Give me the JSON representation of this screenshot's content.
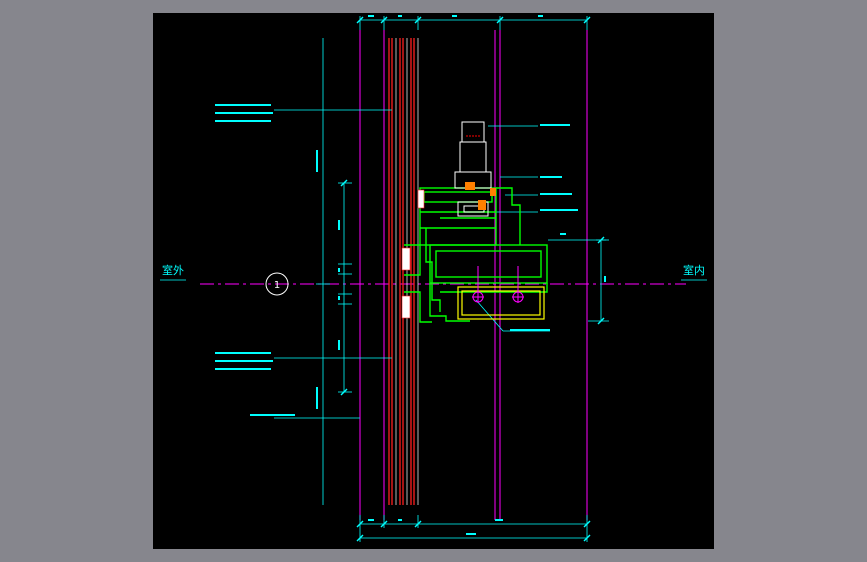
{
  "drawing": {
    "labels": {
      "exterior": "室外",
      "interior": "室内",
      "section_marker": "1"
    },
    "colors": {
      "background": "#000000",
      "frame": "#86868d",
      "dimension": "#00ffff",
      "glass": "#ff2020",
      "frame_line": "#ff00ff",
      "profile": "#00ff00",
      "hardware": "#ffffff",
      "anchor": "#ffff00",
      "orange_detail": "#ff8000"
    }
  }
}
